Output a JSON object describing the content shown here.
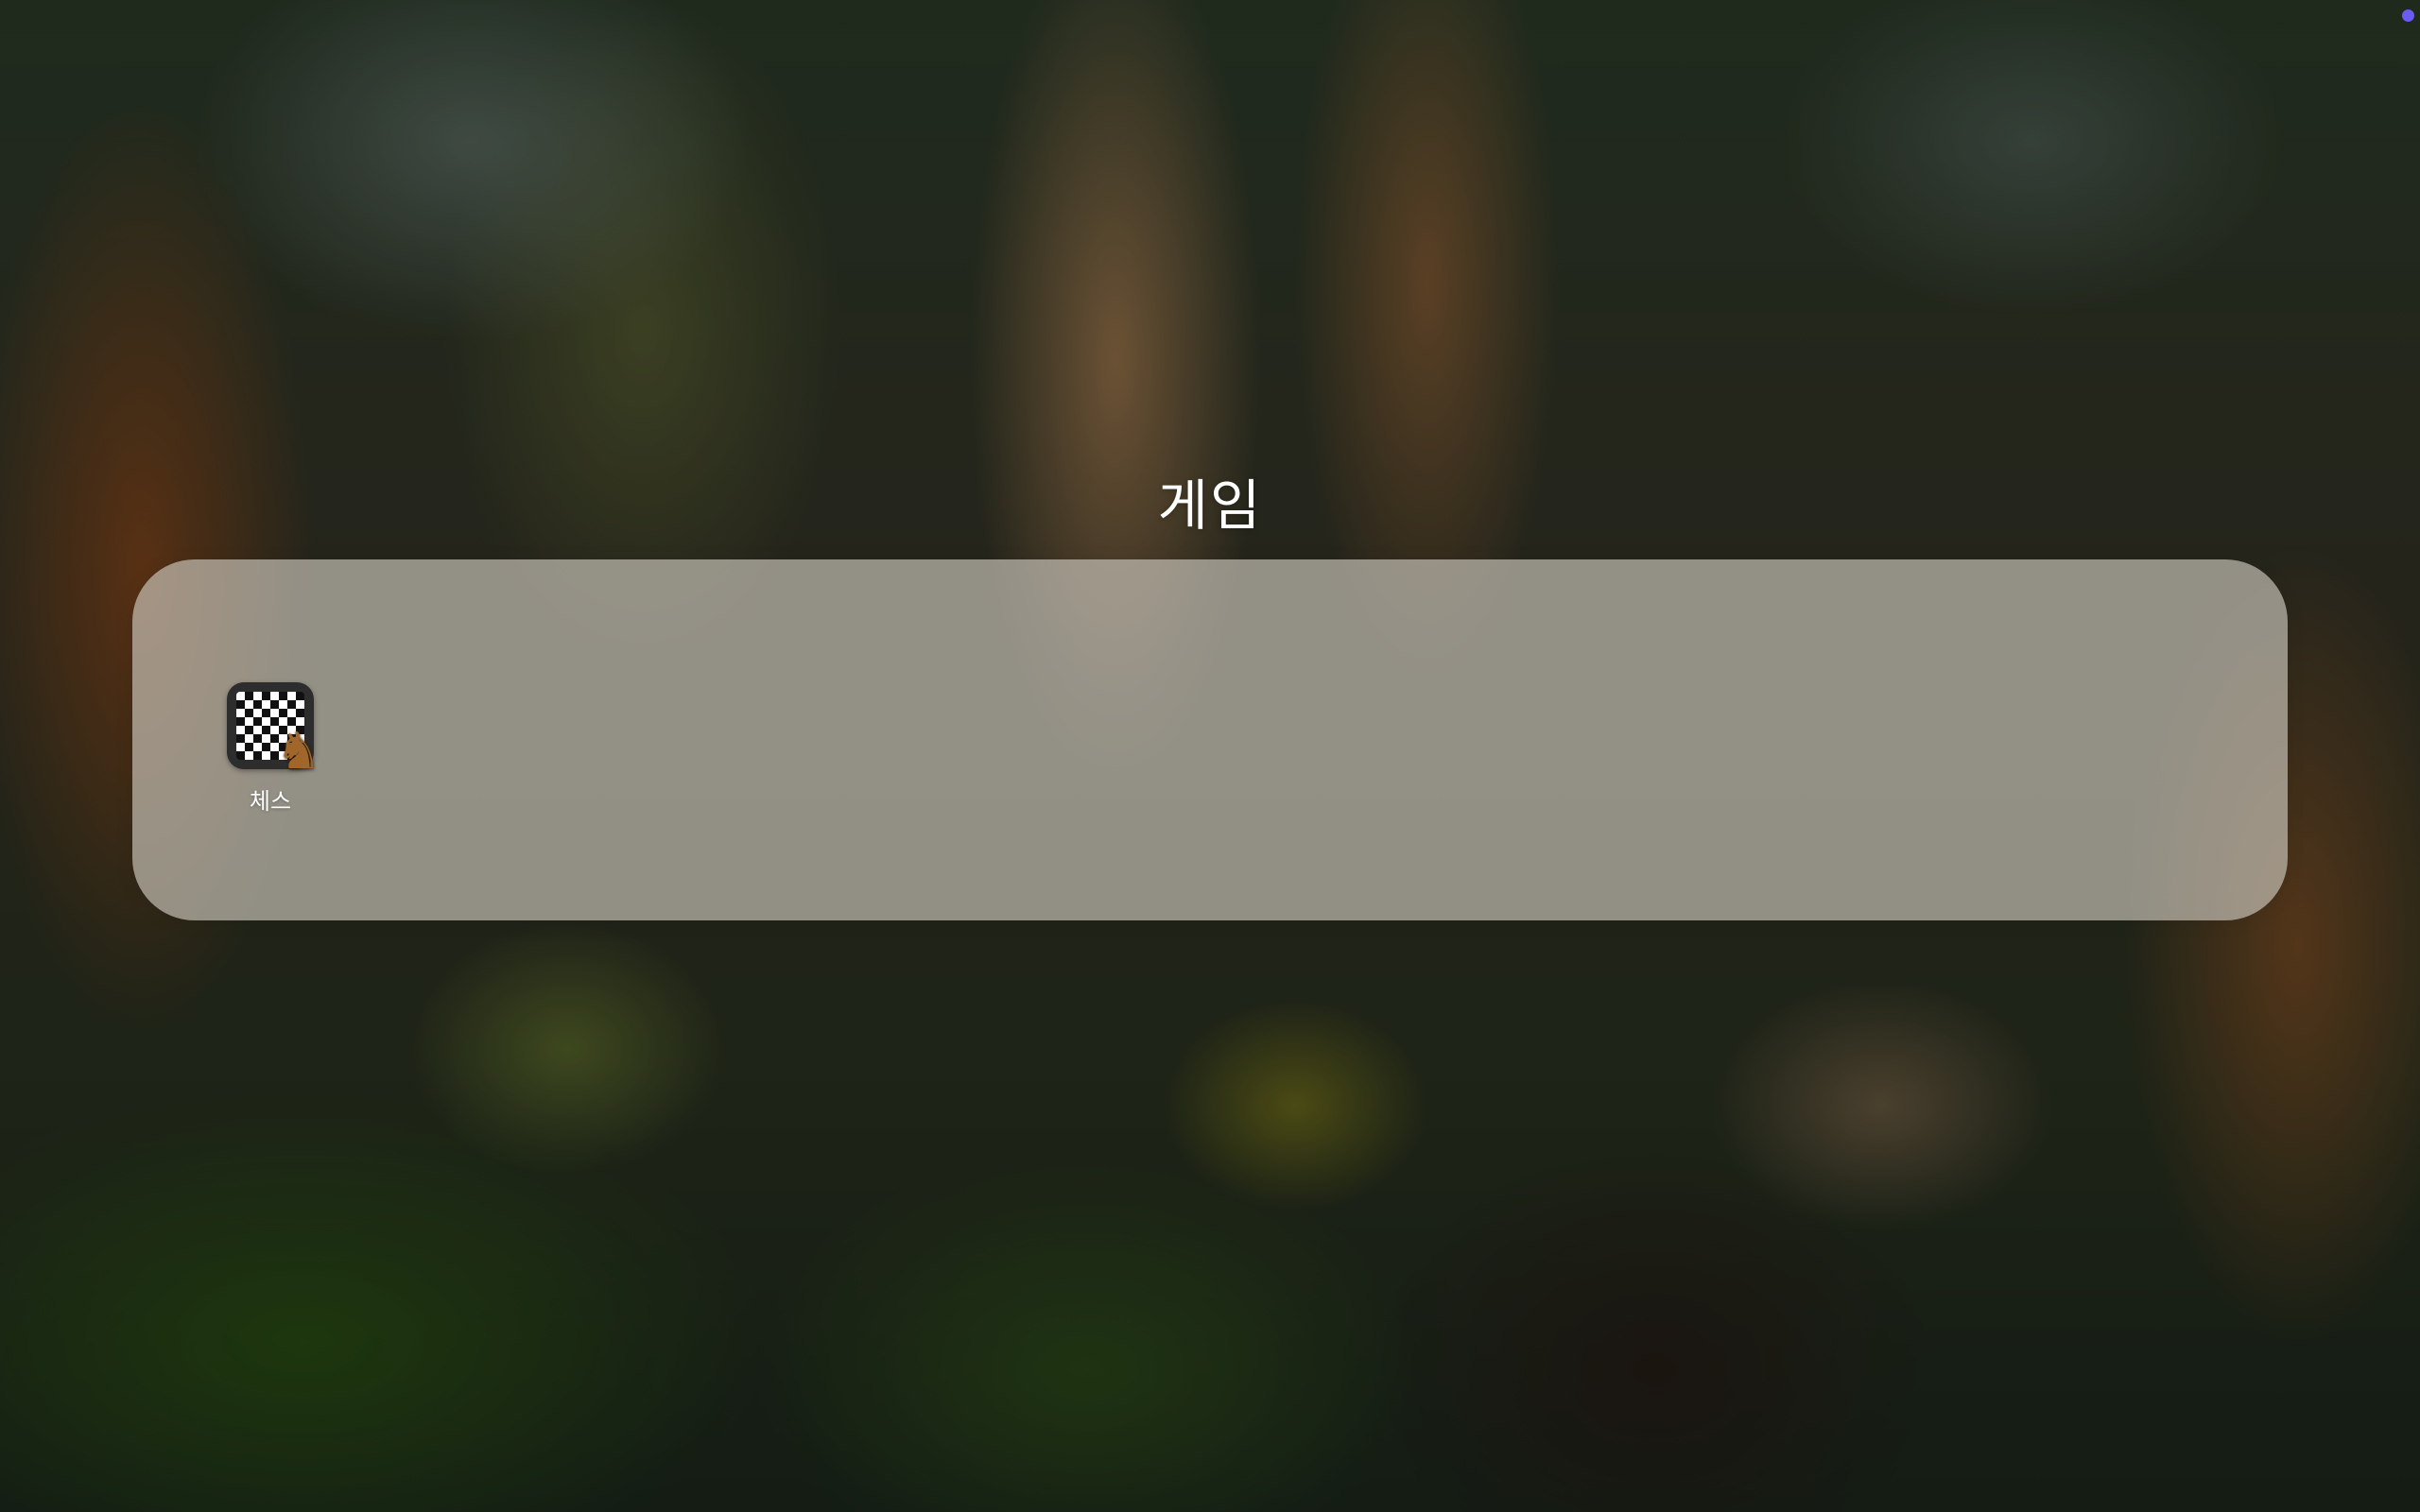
{
  "folder": {
    "title": "게임",
    "apps": [
      {
        "label": "체스",
        "icon": "chess-icon"
      }
    ]
  },
  "status_indicator": {
    "color": "#6a5bf2"
  }
}
